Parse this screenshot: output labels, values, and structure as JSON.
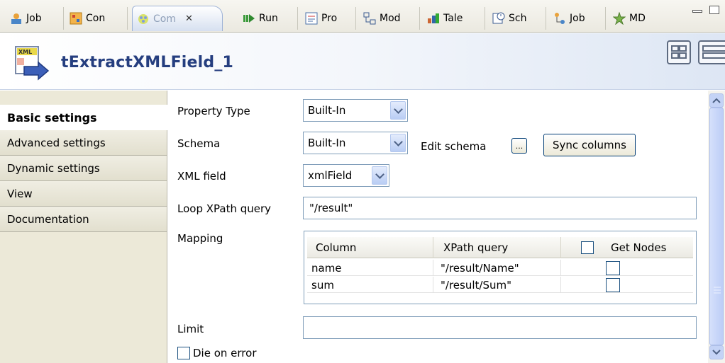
{
  "tabs": [
    {
      "label": "Job",
      "icon": "job-icon",
      "active": false
    },
    {
      "label": "Con",
      "icon": "contexts-icon",
      "active": false
    },
    {
      "label": "Com",
      "icon": "component-icon",
      "active": true
    },
    {
      "label": "Run",
      "icon": "run-icon",
      "active": false
    },
    {
      "label": "Pro",
      "icon": "problems-icon",
      "active": false
    },
    {
      "label": "Mod",
      "icon": "modules-icon",
      "active": false
    },
    {
      "label": "Tale",
      "icon": "talend-icon",
      "active": false
    },
    {
      "label": "Sch",
      "icon": "scheduler-icon",
      "active": false
    },
    {
      "label": "Job",
      "icon": "job-hierarchy-icon",
      "active": false
    },
    {
      "label": "MD",
      "icon": "metadata-icon",
      "active": false
    }
  ],
  "header": {
    "component_name": "tExtractXMLField_1",
    "icon": "xml-extract-icon"
  },
  "nav": {
    "items": [
      {
        "label": "Basic settings",
        "active": true
      },
      {
        "label": "Advanced settings",
        "active": false
      },
      {
        "label": "Dynamic settings",
        "active": false
      },
      {
        "label": "View",
        "active": false
      },
      {
        "label": "Documentation",
        "active": false
      }
    ]
  },
  "form": {
    "property_type": {
      "label": "Property Type",
      "value": "Built-In"
    },
    "schema": {
      "label": "Schema",
      "value": "Built-In",
      "edit_label": "Edit schema",
      "ellipsis": "...",
      "sync_label": "Sync columns"
    },
    "xml_field": {
      "label": "XML field",
      "value": "xmlField"
    },
    "loop_xpath": {
      "label": "Loop XPath query",
      "value": "\"/result\""
    },
    "mapping": {
      "label": "Mapping",
      "headers": [
        "Column",
        "XPath query",
        "Get Nodes"
      ],
      "rows": [
        {
          "column": "name",
          "xpath": "\"/result/Name\"",
          "get_nodes": false
        },
        {
          "column": "sum",
          "xpath": "\"/result/Sum\"",
          "get_nodes": false
        }
      ]
    },
    "limit": {
      "label": "Limit",
      "value": ""
    },
    "die_on_error": {
      "label": "Die on error",
      "checked": false
    }
  },
  "colors": {
    "title_blue": "#253e7f",
    "nav_bg": "#ece9d8",
    "scroll_blue": "#c4d3f6"
  }
}
